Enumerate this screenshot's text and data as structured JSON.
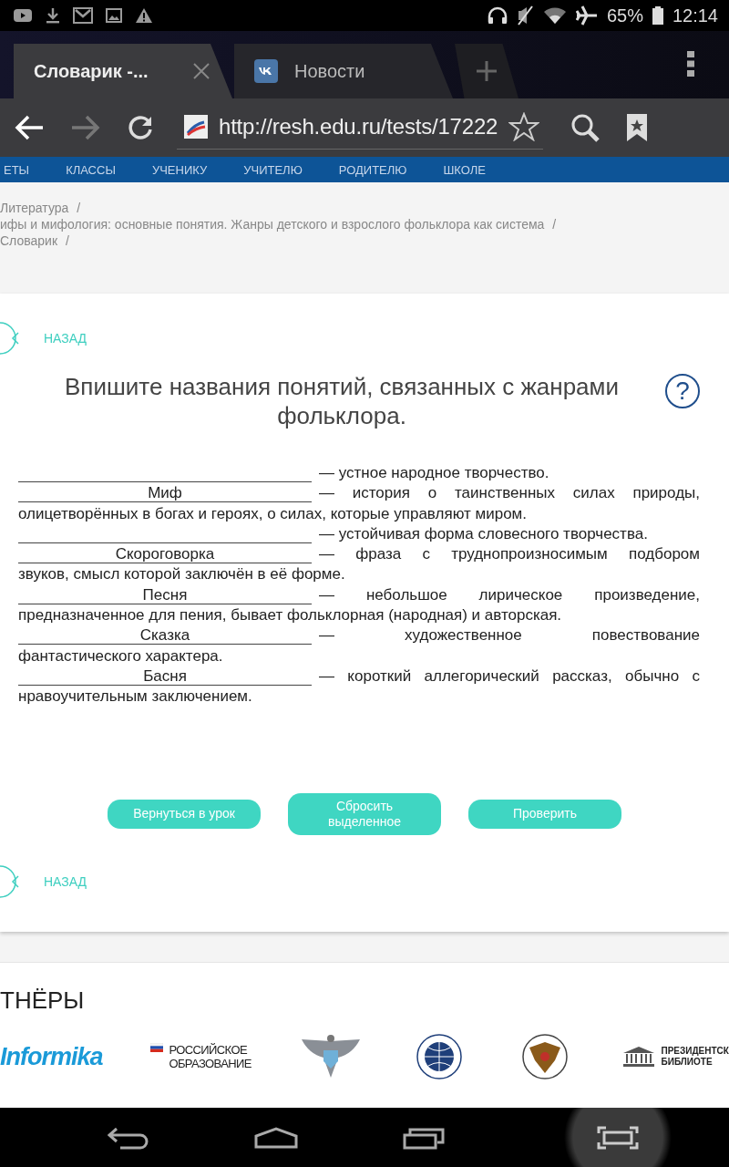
{
  "status_bar": {
    "battery": "65%",
    "time": "12:14"
  },
  "browser": {
    "tabs": [
      {
        "title": "Словарик -...",
        "selected": true,
        "kind": "page"
      },
      {
        "title": "Новости",
        "selected": false,
        "kind": "vk"
      }
    ],
    "url": "http://resh.edu.ru/tests/17222"
  },
  "site_nav": [
    "ЕТЫ",
    "КЛАССЫ",
    "УЧЕНИКУ",
    "УЧИТЕЛЮ",
    "РОДИТЕЛЮ",
    "ШКОЛЕ"
  ],
  "breadcrumbs": [
    {
      "label": "Литература",
      "separator": "/"
    },
    {
      "label": "ифы и мифология: основные понятия. Жанры детского и взрослого фольклора как система",
      "separator": "/"
    },
    {
      "label": "Словарик",
      "separator": "/"
    }
  ],
  "top_back_link": "НАЗАД",
  "task": {
    "title": "Впишите названия понятий, связанных с жанрами фольклора.",
    "help": "?",
    "items": [
      {
        "definition": "— устное народное творчество."
      },
      {
        "answer": "Миф",
        "definition": "— история о таинственных силах природы,",
        "continuation": "олицетворённых в богах и героях, о силах, которые управляют миром."
      },
      {
        "definition": "— устойчивая форма словесного творчества."
      },
      {
        "answer": "Скороговорка",
        "definition": "— фраза с труднопроизносимым подбором",
        "continuation": "звуков, смысл которой заключён в её форме."
      },
      {
        "answer": "Песня",
        "definition": "— небольшое лирическое произведение,",
        "continuation": "предназначенное для пения, бывает фольклорная (народная) и авторская."
      },
      {
        "answer": "Сказка",
        "definition": "— художественное повествование",
        "continuation": "фантастического характера."
      },
      {
        "answer": "Басня",
        "definition": "— короткий аллегорический рассказ, обычно с",
        "continuation": "нравоучительным заключением."
      }
    ]
  },
  "buttons": [
    "Вернуться в урок",
    "Сбросить выделенное",
    "Проверить"
  ],
  "bottom_back_link": "НАЗАД",
  "partners": {
    "title": "ТНЁРЫ",
    "logos": [
      {
        "kind": "informika",
        "lines": [
          "Informika"
        ]
      },
      {
        "kind": "flag",
        "lines": [
          "РОССИЙСКОЕ",
          "ОБРАЗОВАНИЕ"
        ]
      },
      {
        "kind": "emblem"
      },
      {
        "kind": "globe"
      },
      {
        "kind": "eagle"
      },
      {
        "kind": "library",
        "lines": [
          "ПРЕЗИДЕНТСК",
          "БИБЛИОТЕ"
        ]
      }
    ]
  }
}
